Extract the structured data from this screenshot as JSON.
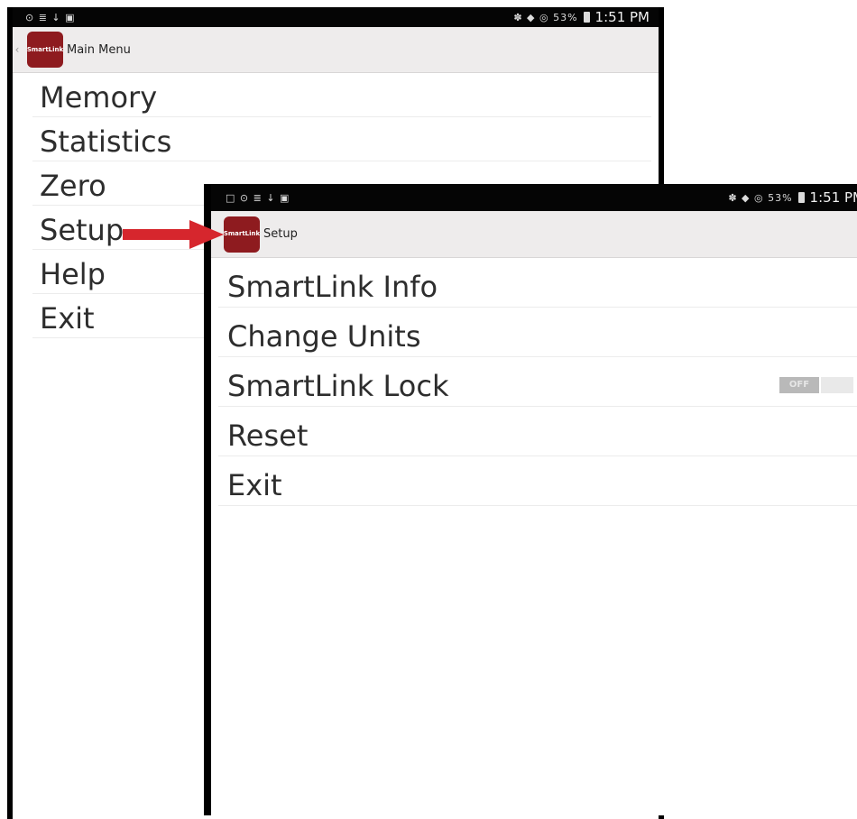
{
  "main_phone": {
    "status_bar": {
      "left_icons": "⊙ ≣ ↓ ▣",
      "right_icons": "✽ ◆ ◎ 53%",
      "time": "1:51 PM"
    },
    "action_bar": {
      "logo_text": "SmartLink",
      "title": "Main Menu"
    },
    "menu": [
      "Memory",
      "Statistics",
      "Zero",
      "Setup",
      "Help",
      "Exit"
    ]
  },
  "setup_phone": {
    "status_bar": {
      "left_icons": "□ ⊙ ≣ ↓ ▣",
      "right_icons": "✽ ◆ ◎ 53%",
      "time": "1:51 PM"
    },
    "action_bar": {
      "logo_text": "SmartLink",
      "title": "Setup"
    },
    "menu": [
      "SmartLink Info",
      "Change Units",
      "SmartLink Lock",
      "Reset",
      "Exit"
    ],
    "lock_toggle": {
      "label": "OFF",
      "state": "off"
    }
  },
  "colors": {
    "brand": "#8e1b1f",
    "arrow": "#d6262d",
    "action_bar": "#eeecec"
  },
  "icons": {
    "arrow": "red-arrow-pointing-right",
    "back": "chevron-left-icon"
  }
}
